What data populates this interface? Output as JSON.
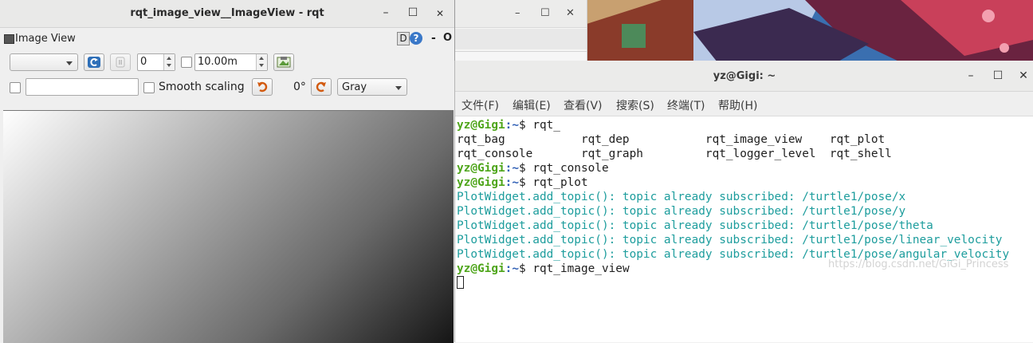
{
  "rqt": {
    "title": "rqt_image_view__ImageView - rqt",
    "min": "–",
    "max": "☐",
    "close": "✕",
    "plugin_label": "Image View",
    "d_label": "D",
    "help": "?",
    "dash": "-",
    "o": "O",
    "topic_value": "",
    "spin_value": "0",
    "timeout_value": "10.00m",
    "smooth_label": "Smooth scaling",
    "rotation": "0°",
    "colormap": "Gray"
  },
  "bg_window": {
    "min": "–",
    "max": "☐",
    "close": "✕"
  },
  "terminal": {
    "title": "yz@Gigi: ~",
    "min": "–",
    "max": "☐",
    "close": "✕",
    "menu": [
      "文件(F)",
      "编辑(E)",
      "查看(V)",
      "搜索(S)",
      "终端(T)",
      "帮助(H)"
    ],
    "user": "yz@Gigi",
    "path": ":~",
    "prompt": "$",
    "cmd1": " rqt_",
    "completion_row1": "rqt_bag           rqt_dep           rqt_image_view    rqt_plot",
    "completion_row2": "rqt_console       rqt_graph         rqt_logger_level  rqt_shell",
    "cmd2": " rqt_console",
    "cmd3": " rqt_plot",
    "warn1": "PlotWidget.add_topic(): topic already subscribed: /turtle1/pose/x",
    "warn2": "PlotWidget.add_topic(): topic already subscribed: /turtle1/pose/y",
    "warn3": "PlotWidget.add_topic(): topic already subscribed: /turtle1/pose/theta",
    "warn4": "PlotWidget.add_topic(): topic already subscribed: /turtle1/pose/linear_velocity",
    "warn5": "PlotWidget.add_topic(): topic already subscribed: /turtle1/pose/angular_velocity",
    "cmd4": " rqt_image_view",
    "watermark": "https://blog.csdn.net/GiGi_Princess"
  }
}
